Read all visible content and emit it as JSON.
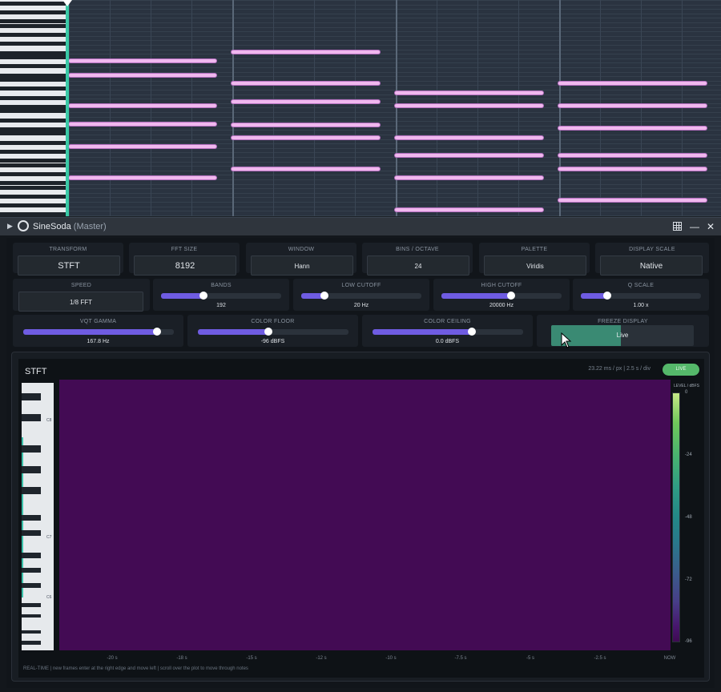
{
  "window": {
    "title": "SineSoda",
    "subtitle": "(Master)",
    "controls": [
      "grid-icon",
      "minimize-icon",
      "close-icon"
    ]
  },
  "controls_row1": [
    {
      "label": "TRANSFORM",
      "value": "STFT"
    },
    {
      "label": "FFT SIZE",
      "value": "8192"
    },
    {
      "label": "WINDOW",
      "value": "Hann"
    },
    {
      "label": "BINS / OCTAVE",
      "value": "24"
    },
    {
      "label": "PALETTE",
      "value": "Viridis"
    },
    {
      "label": "DISPLAY SCALE",
      "value": "Native"
    }
  ],
  "speed": {
    "label": "SPEED",
    "value": "1/8 FFT"
  },
  "sliders_row2": [
    {
      "label": "BANDS",
      "value": "192",
      "fraction": 0.35
    },
    {
      "label": "LOW CUTOFF",
      "value": "20 Hz",
      "fraction": 0.19
    },
    {
      "label": "HIGH CUTOFF",
      "value": "20000 Hz",
      "fraction": 0.58
    },
    {
      "label": "Q SCALE",
      "value": "1.00 x",
      "fraction": 0.22
    }
  ],
  "sliders_row3": [
    {
      "label": "VQT GAMMA",
      "value": "167.8 Hz",
      "fraction": 0.89
    },
    {
      "label": "COLOR FLOOR",
      "value": "-96 dBFS",
      "fraction": 0.47
    },
    {
      "label": "COLOR CEILING",
      "value": "0.0 dBFS",
      "fraction": 0.66
    }
  ],
  "freeze": {
    "label": "FREEZE DISPLAY",
    "value": "Live",
    "fraction": 0.49
  },
  "spectrogram": {
    "title": "STFT",
    "info": "23.22 ms / px  |  2.5 s / div",
    "live_badge": "LIVE",
    "colorbar_title": "LEVEL / dBFS",
    "colorbar_ticks": [
      "0",
      "-24",
      "-48",
      "-72",
      "-96"
    ],
    "x_ticks": [
      "-20 s",
      "-18 s",
      "-15 s",
      "-12 s",
      "-10 s",
      "-7.5 s",
      "-5 s",
      "-2.5 s",
      "NOW"
    ],
    "octave_labels": [
      "C8",
      "C7",
      "C6"
    ],
    "footnote": "REAL-TIME  |  new frames enter at the right edge and move left  |  scroll over the plot to move through notes",
    "plot_color": "#430b54"
  },
  "colors": {
    "accent": "#6f5ce2",
    "playhead": "#39c9a6",
    "note": "#f0b8ee",
    "live": "#55b86a",
    "freeze_fill": "#3a8a73"
  }
}
